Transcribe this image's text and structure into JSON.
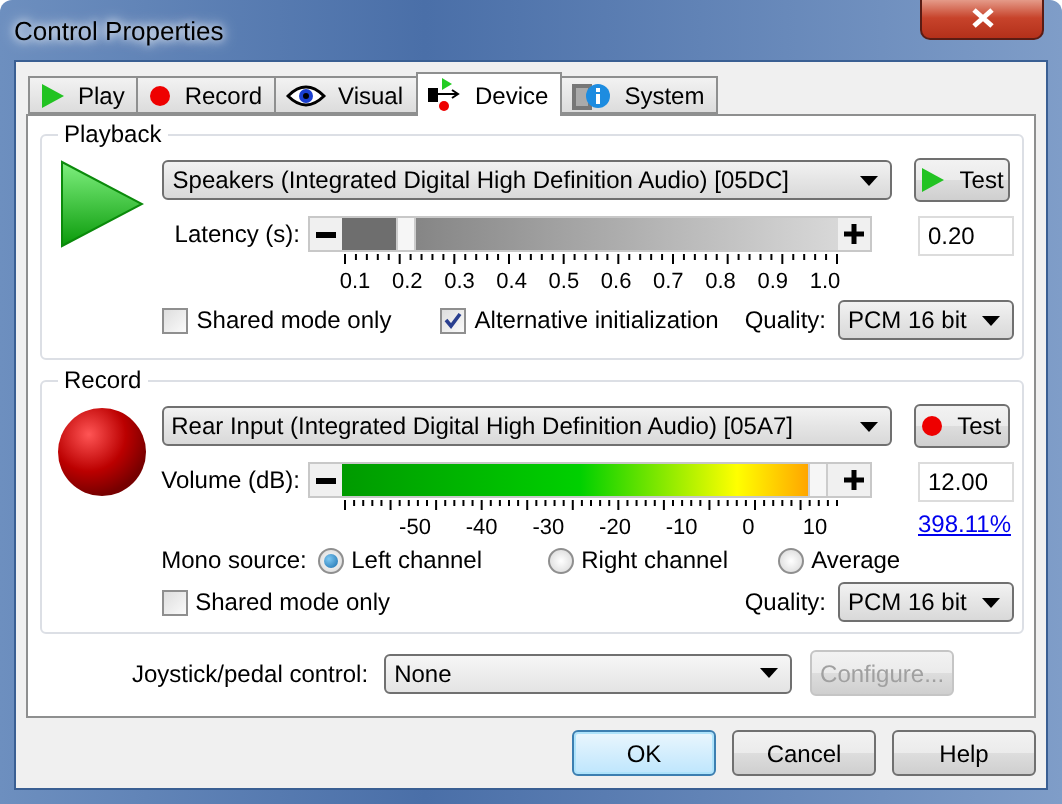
{
  "window": {
    "title": "Control Properties"
  },
  "tabs": [
    {
      "label": "Play",
      "kind": "play",
      "selected": false
    },
    {
      "label": "Record",
      "kind": "record",
      "selected": false
    },
    {
      "label": "Visual",
      "kind": "visual",
      "selected": false
    },
    {
      "label": "Device",
      "kind": "device",
      "selected": true
    },
    {
      "label": "System",
      "kind": "system",
      "selected": false
    }
  ],
  "playback": {
    "title": "Playback",
    "device": "Speakers (Integrated Digital High Definition Audio) [05DC]",
    "test_button": "Test",
    "latency": {
      "label": "Latency (s):",
      "level": 0.13,
      "value": "0.20",
      "ticks": [
        "0.1",
        "0.2",
        "0.3",
        "0.4",
        "0.5",
        "0.6",
        "0.7",
        "0.8",
        "0.9",
        "1.0"
      ]
    },
    "checkboxes": [
      {
        "label": "Shared mode only",
        "checked": false
      },
      {
        "label": "Alternative initialization",
        "checked": true
      }
    ],
    "quality": {
      "label": "Quality:",
      "value": "PCM 16 bit"
    }
  },
  "record": {
    "title": "Record",
    "device": "Rear Input (Integrated Digital High Definition Audio) [05A7]",
    "test_button": "Test",
    "volume": {
      "label": "Volume (dB):",
      "level": 0.96,
      "value": "12.00",
      "percent": "398.11%",
      "ticks": [
        "-50",
        "-40",
        "-30",
        "-20",
        "-10",
        "0",
        "10"
      ]
    },
    "mono_source": {
      "label": "Mono source:",
      "options": [
        {
          "label": "Left channel",
          "selected": true
        },
        {
          "label": "Right channel",
          "selected": false
        },
        {
          "label": "Average",
          "selected": false
        }
      ]
    },
    "checkboxes": [
      {
        "label": "Shared mode only",
        "checked": false
      }
    ],
    "quality": {
      "label": "Quality:",
      "value": "PCM 16 bit"
    }
  },
  "joystick": {
    "label": "Joystick/pedal control:",
    "value": "None",
    "configure_button": {
      "label": "Configure...",
      "disabled": true
    }
  },
  "buttons": [
    {
      "label": "OK",
      "default": true
    },
    {
      "label": "Cancel",
      "default": false
    },
    {
      "label": "Help",
      "default": false
    }
  ]
}
